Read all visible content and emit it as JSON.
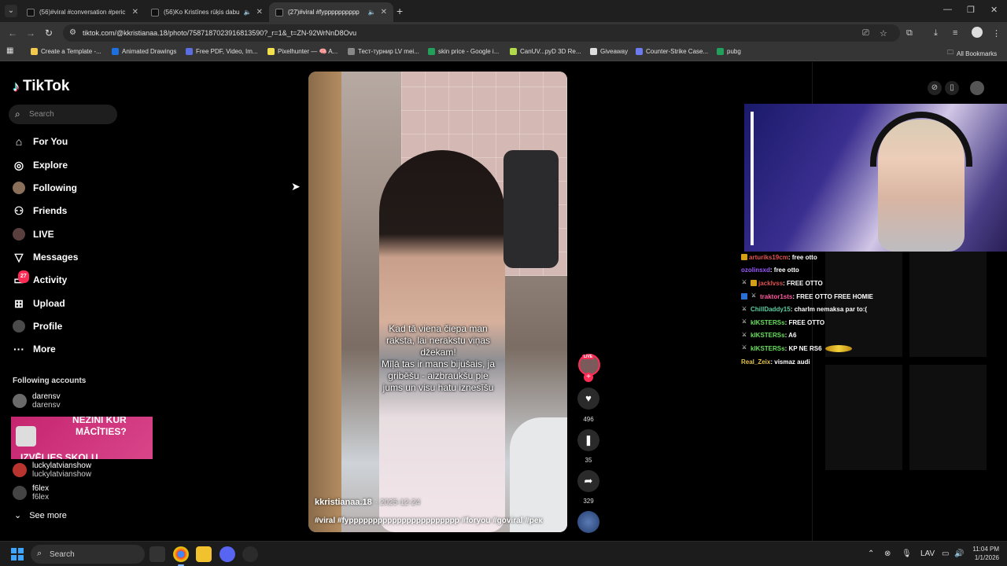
{
  "browser": {
    "tabs": [
      {
        "title": "(56)#viral #conversation #peric",
        "active": false
      },
      {
        "title": "(56)Ko Kristīnes rūķis dabuj",
        "active": false
      },
      {
        "title": "(27)#viral #fypppppppppp",
        "active": true
      }
    ],
    "url": "tiktok.com/@kkristianaa.18/photo/7587187023916813590?_r=1&_t=ZN-92WrNnD8Ovu",
    "bookmarks": [
      {
        "label": "Create a Template -...",
        "color": "#f2c94c"
      },
      {
        "label": "Animated Drawings",
        "color": "#1e6fe0"
      },
      {
        "label": "Free PDF, Video, Im...",
        "color": "#5b6ee1"
      },
      {
        "label": "Pixelhunter — 🧠 A...",
        "color": "#f2e14c"
      },
      {
        "label": "Тест-турнир LV mei...",
        "color": "#888888"
      },
      {
        "label": "skin price - Google i...",
        "color": "#22a05b"
      },
      {
        "label": "CanUV...pyD 3D Re...",
        "color": "#b0d94c"
      },
      {
        "label": "Giveaway",
        "color": "#dddddd"
      },
      {
        "label": "Counter-Strike Case...",
        "color": "#6c7bf0"
      },
      {
        "label": "pubg",
        "color": "#22a05b"
      }
    ],
    "all_bookmarks": "All Bookmarks"
  },
  "sidebar": {
    "logo": "TikTok",
    "search_placeholder": "Search",
    "menu": [
      {
        "label": "For You",
        "icon": "home-icon"
      },
      {
        "label": "Explore",
        "icon": "compass-icon"
      },
      {
        "label": "Following",
        "icon": "following-avatar-icon"
      },
      {
        "label": "Friends",
        "icon": "friends-icon"
      },
      {
        "label": "LIVE",
        "icon": "live-icon"
      },
      {
        "label": "Messages",
        "icon": "messages-icon"
      },
      {
        "label": "Activity",
        "icon": "activity-icon",
        "badge": "27"
      },
      {
        "label": "Upload",
        "icon": "upload-icon"
      },
      {
        "label": "Profile",
        "icon": "profile-avatar-icon"
      },
      {
        "label": "More",
        "icon": "more-icon"
      }
    ],
    "following_title": "Following accounts",
    "accounts": [
      {
        "name": "darensv",
        "sub": "darensv"
      },
      {
        "name": "luckylatvianshow",
        "sub": "luckylatvianshow"
      },
      {
        "name": "f6lex",
        "sub": "f6lex"
      }
    ],
    "see_more": "See more",
    "ad": {
      "line1": "NEZINI KUR",
      "line2": "MĀCĪTIES?",
      "line3": "IZVĒLIES SKOLU"
    }
  },
  "video": {
    "caption": [
      "Kad tā viena čiepa man",
      "raksta, lai nerakstu viņas",
      "džekam!",
      "Mīļā tas ir mans bijušais, ja",
      "gribēšu - aizbraukšu pie",
      "jums un visu hatu iznesīšu"
    ],
    "author": "kkristianaa.18",
    "date": "2025-12-24",
    "tags": "#viral #fyppppppppppppppppppppppp #foryou #goviral #рек",
    "live_label": "LIVE",
    "likes": "496",
    "saves": "35",
    "shares": "329"
  },
  "chat": [
    {
      "user": "arturiks19cm",
      "color": "#e05252",
      "text": ": free otto",
      "badge": true
    },
    {
      "user": "ozolinsxd",
      "color": "#9b59ff",
      "text": ": free otto",
      "badge": false
    },
    {
      "user": "jacklvss",
      "color": "#e05252",
      "text": ": FREE OTTO",
      "badge": true
    },
    {
      "user": "traktor1sts",
      "color": "#ff5aa0",
      "text": ": FREE OTTO FREE HOMIE",
      "badge": true
    },
    {
      "user": "ChillDaddy15",
      "color": "#55d0a0",
      "text": ": charlm nemaksa par to:(",
      "badge": false
    },
    {
      "user": "kIKSTERSs",
      "color": "#66e05a",
      "text": ": FREE OTTO",
      "badge": false
    },
    {
      "user": "kIKSTERSs",
      "color": "#66e05a",
      "text": ": A6",
      "badge": false
    },
    {
      "user": "kIKSTERSs",
      "color": "#66e05a",
      "text": ": KP NE RS6",
      "badge": false
    },
    {
      "user": "Real_Zeix",
      "color": "#e0c04a",
      "text": ": vismaz audi",
      "badge": false
    }
  ],
  "taskbar": {
    "search_placeholder": "Search",
    "lang": "LAV",
    "time": "11:04 PM",
    "date": "1/1/2026"
  }
}
